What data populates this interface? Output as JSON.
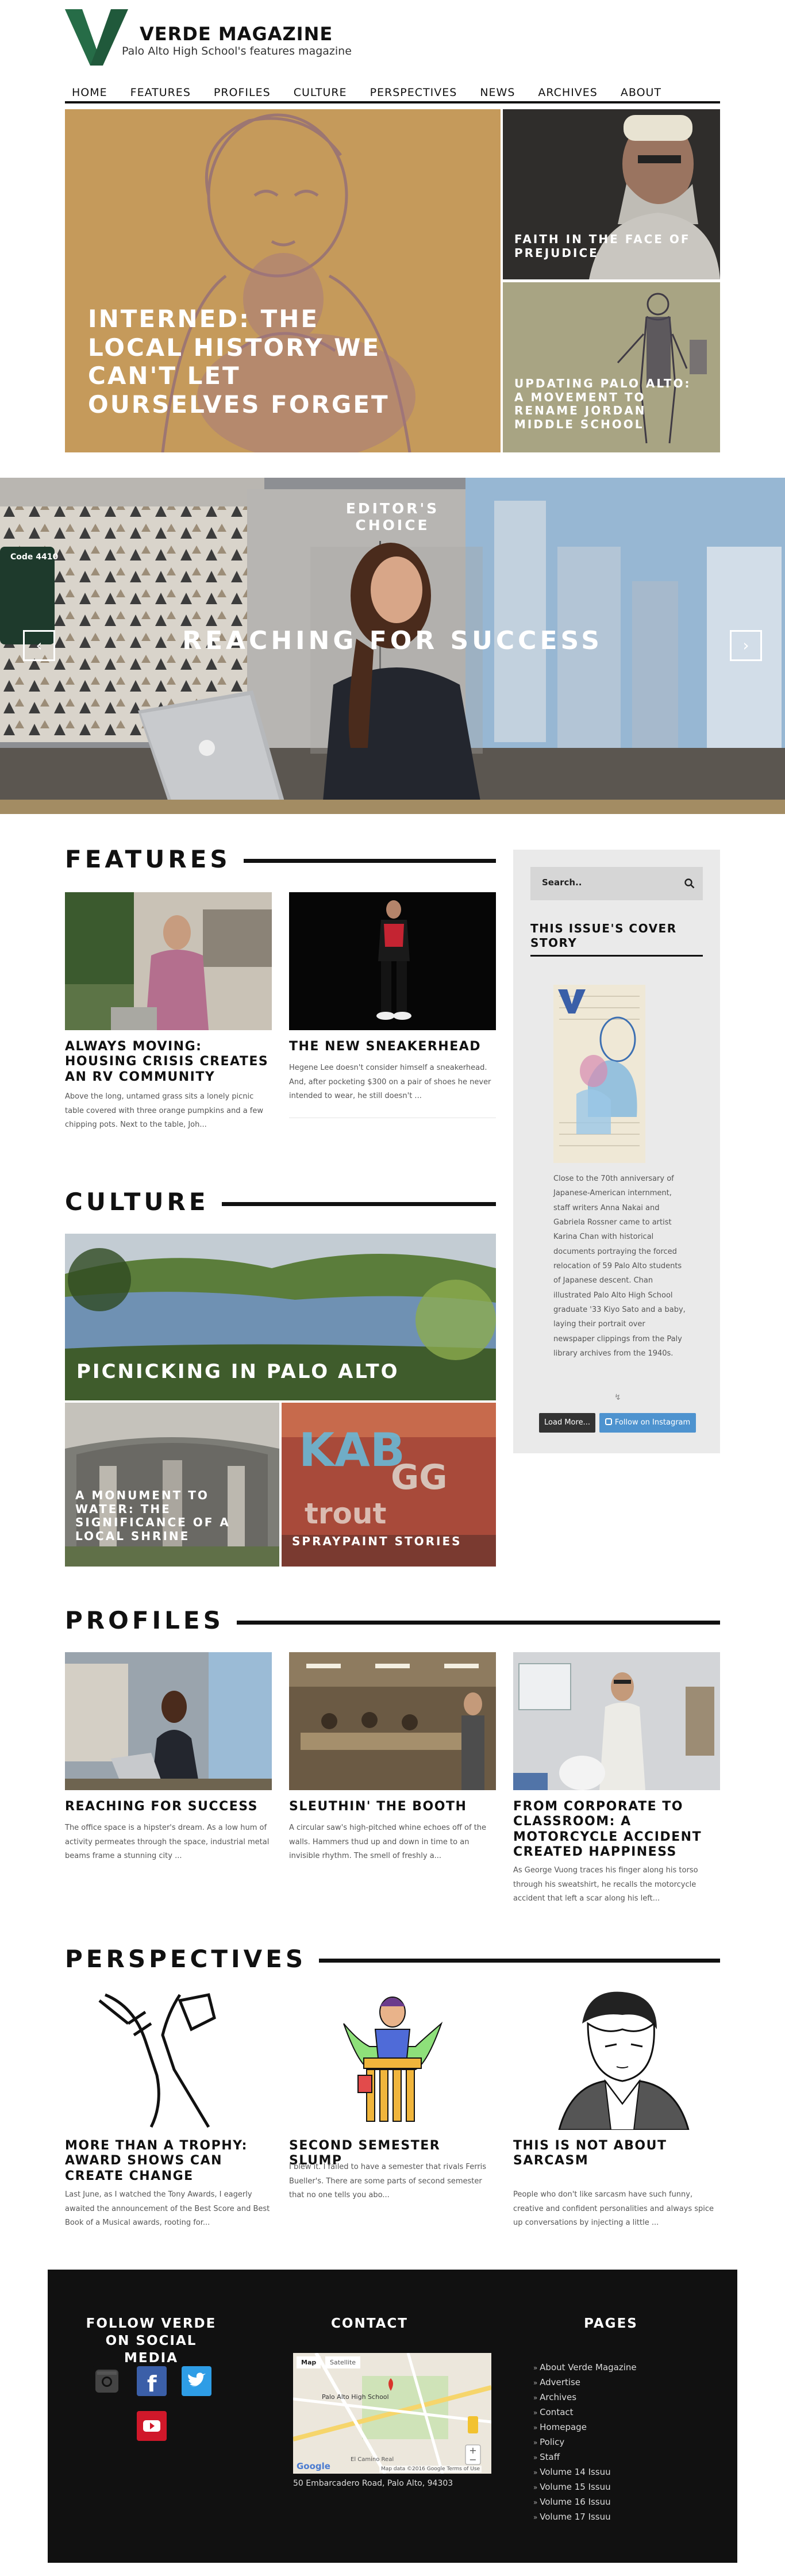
{
  "colors": {
    "brand_green": "#20593b",
    "accent_blue": "#3a6fb0",
    "instagram_btn": "#4e93cf",
    "load_more_btn": "#333333",
    "tile_tan": "#c59a5b",
    "tile_sage": "#a8a483"
  },
  "header": {
    "title": "VERDE MAGAZINE",
    "subtitle": "Palo Alto High School's features magazine",
    "nav": [
      "HOME",
      "FEATURES",
      "PROFILES",
      "CULTURE",
      "PERSPECTIVES",
      "NEWS",
      "ARCHIVES",
      "ABOUT"
    ]
  },
  "hero": {
    "main_title": "INTERNED: THE LOCAL HISTORY WE CAN'T LET OURSELVES FORGET",
    "side_top_title": "FAITH IN THE FACE OF PREJUDICE",
    "side_bottom_title": "UPDATING PALO ALTO: A MOVEMENT TO RENAME JORDAN MIDDLE SCHOOL"
  },
  "slider": {
    "kicker": "EDITOR'S CHOICE",
    "title": "REACHING FOR SUCCESS",
    "prev_icon": "chevron-left-icon",
    "next_icon": "chevron-right-icon",
    "wall_sign": "Code 4410"
  },
  "features": {
    "heading": "FEATURES",
    "cards": [
      {
        "title": "ALWAYS MOVING: HOUSING CRISIS CREATES AN RV COMMUNITY",
        "excerpt": "Above the long, untamed grass sits a lonely picnic table covered with three orange pumpkins and a few chipping pots.  Next to the table, Joh..."
      },
      {
        "title": "THE NEW SNEAKERHEAD",
        "excerpt": "Hegene Lee doesn't consider himself a sneakerhead. And, after pocketing $300 on a pair of shoes he never intended to wear, he still doesn't ..."
      }
    ]
  },
  "culture": {
    "heading": "CULTURE",
    "main_title": "PICNICKING IN PALO ALTO",
    "sub_left_title": "A MONUMENT TO WATER: THE SIGNIFICANCE OF A LOCAL SHRINE",
    "sub_right_title": "SPRAYPAINT STORIES"
  },
  "sidebar": {
    "search_placeholder": "Search..",
    "search_icon": "search-icon",
    "cover_heading": "THIS ISSUE'S COVER STORY",
    "cover_caption": "Close to the 70th anniversary of Japanese-American internment, staff writers Anna Nakai and Gabriela Rossner came to artist Karina Chan with historical documents portraying the forced relocation of 59 Palo Alto students of Japanese descent. Chan illustrated Palo Alto High School graduate '33 Kiyo Sato and a baby, laying their portrait over newspaper clippings from the Paly library archives from the 1940s.",
    "load_more": "Load More...",
    "follow_instagram": "Follow on Instagram"
  },
  "profiles": {
    "heading": "PROFILES",
    "cards": [
      {
        "title": "REACHING FOR SUCCESS",
        "excerpt": "The office space is a hipster's dream. As a low hum of activity permeates through the space, industrial metal beams frame a stunning city ..."
      },
      {
        "title": "SLEUTHIN' THE BOOTH",
        "excerpt": "A circular saw's high-pitched whine echoes off of the walls. Hammers thud up and down in time to an invisible rhythm. The smell of freshly a..."
      },
      {
        "title": "FROM CORPORATE TO CLASSROOM: A MOTORCYCLE ACCIDENT CREATED HAPPINESS",
        "excerpt": "As George Vuong traces his finger along his torso through his sweatshirt, he recalls the motorcycle accident that left a scar along his left..."
      }
    ]
  },
  "perspectives": {
    "heading": "PERSPECTIVES",
    "cards": [
      {
        "title": "MORE THAN A TROPHY: AWARD SHOWS CAN CREATE CHANGE",
        "excerpt": "Last June, as I watched the Tony Awards, I eagerly awaited the announcement of the Best Score and Best Book of a Musical awards, rooting for..."
      },
      {
        "title": "SECOND SEMESTER SLUMP",
        "excerpt": "I blew it. I failed to have a semester that rivals Ferris Bueller's. There are some parts of second semester that no one tells you abo..."
      },
      {
        "title": "THIS IS NOT ABOUT SARCASM",
        "excerpt": "People who don't like sarcasm have such funny, creative and confident personalities and always spice up conversations by injecting a little ..."
      }
    ]
  },
  "footer": {
    "social_heading": "FOLLOW VERDE ON SOCIAL MEDIA",
    "contact_heading": "CONTACT",
    "pages_heading": "PAGES",
    "address": "50 Embarcadero Road, Palo Alto, 94303",
    "map": {
      "tab_map": "Map",
      "tab_satellite": "Satellite",
      "place_label": "Palo Alto High School",
      "street_label": "El Camino Real",
      "attribution": "Map data ©2016 Google   Terms of Use"
    },
    "social_icons": [
      "instagram-icon",
      "facebook-icon",
      "twitter-icon",
      "youtube-icon"
    ],
    "pages": [
      "About Verde Magazine",
      "Advertise",
      "Archives",
      "Contact",
      "Homepage",
      "Policy",
      "Staff",
      "Volume 14 Issuu",
      "Volume 15 Issuu",
      "Volume 16 Issuu",
      "Volume 17 Issuu"
    ]
  }
}
